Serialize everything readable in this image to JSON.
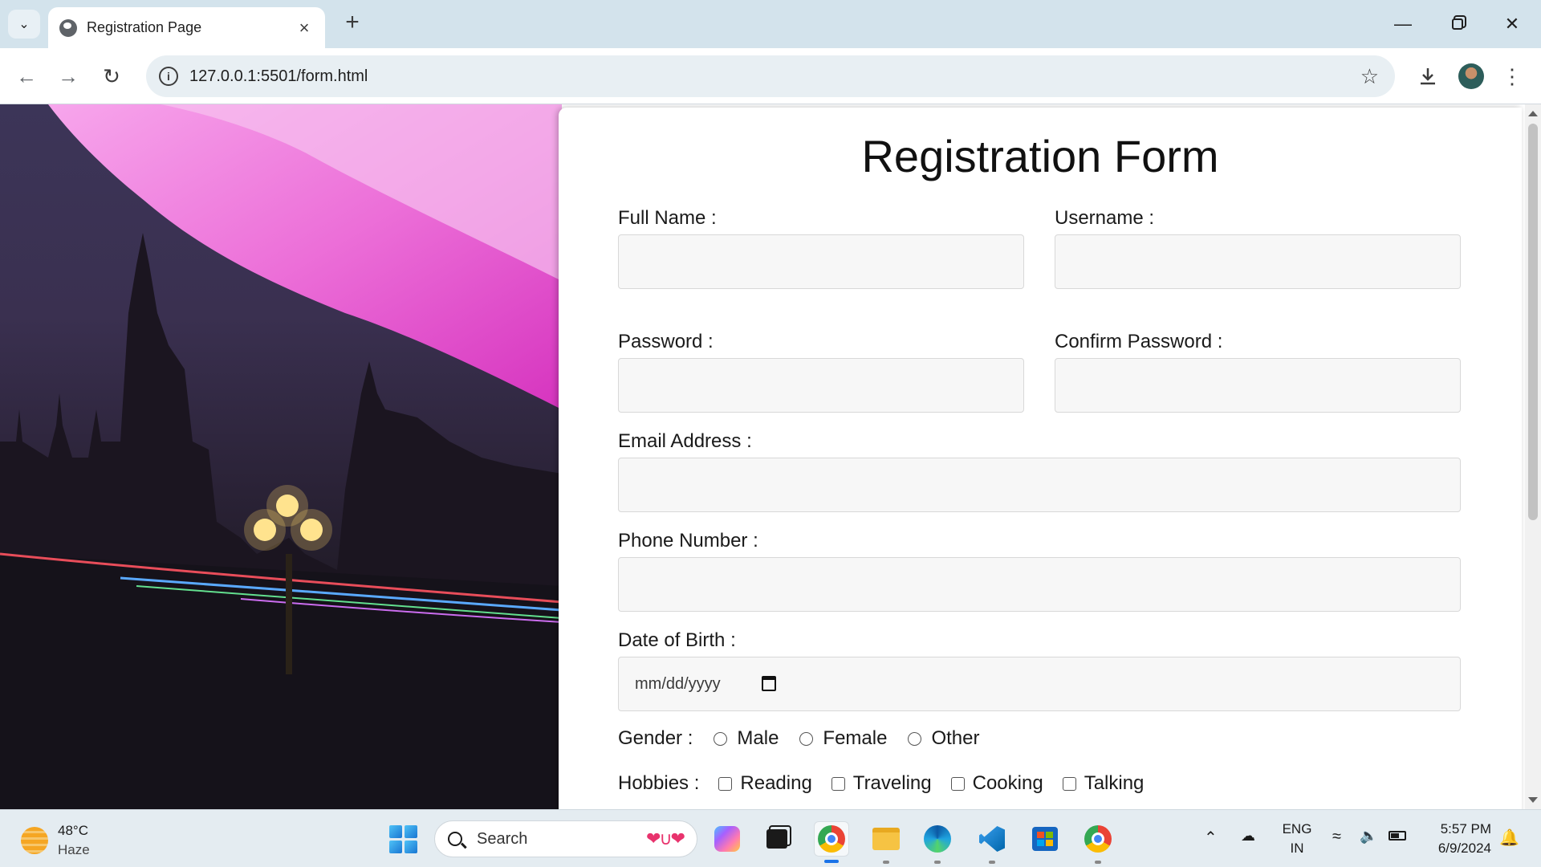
{
  "browser": {
    "tab_title": "Registration Page",
    "url": "127.0.0.1:5501/form.html"
  },
  "form": {
    "title": "Registration Form",
    "full_name_label": "Full Name :",
    "username_label": "Username :",
    "password_label": "Password :",
    "confirm_password_label": "Confirm Password :",
    "email_label": "Email Address :",
    "phone_label": "Phone Number :",
    "dob_label": "Date of Birth :",
    "dob_placeholder": "mm/dd/yyyy",
    "gender_label": "Gender :",
    "gender_options": [
      "Male",
      "Female",
      "Other"
    ],
    "hobbies_label": "Hobbies :",
    "hobby_options": [
      "Reading",
      "Traveling",
      "Cooking",
      "Talking"
    ]
  },
  "taskbar": {
    "weather_temp": "48°C",
    "weather_desc": "Haze",
    "search_text": "Search",
    "lang_line1": "ENG",
    "lang_line2": "IN",
    "time": "5:57 PM",
    "date": "6/9/2024"
  },
  "colors": {
    "tabstrip": "#d3e3ec",
    "chrome_blue": "#1a73e8",
    "hero_accent": "#e85bd3"
  }
}
